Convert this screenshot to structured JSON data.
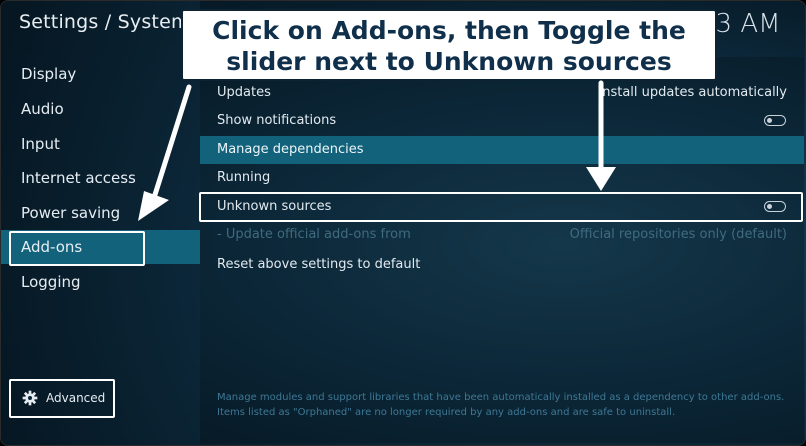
{
  "header": {
    "title": "Settings / System",
    "clock": "23 AM"
  },
  "sidebar": {
    "items": [
      {
        "label": "Display"
      },
      {
        "label": "Audio"
      },
      {
        "label": "Input"
      },
      {
        "label": "Internet access"
      },
      {
        "label": "Power saving"
      },
      {
        "label": "Add-ons",
        "selected": true
      },
      {
        "label": "Logging"
      }
    ],
    "advanced_label": "Advanced"
  },
  "settings": {
    "rows": [
      {
        "label": "Updates",
        "value": "Install updates automatically"
      },
      {
        "label": "Show notifications",
        "control": "toggle",
        "state": "off"
      },
      {
        "label": "Manage dependencies",
        "focused": true
      },
      {
        "label": "Running"
      },
      {
        "label": "Unknown sources",
        "control": "toggle",
        "state": "off"
      },
      {
        "label": "- Update official add-ons from",
        "value": "Official repositories only (default)",
        "disabled": true
      },
      {
        "label": "Reset above settings to default"
      }
    ],
    "help_text": "Manage modules and support libraries that have been automatically installed as a dependency to other add-ons. Items listed as \"Orphaned\" are no longer required by any add-ons and are safe to uninstall."
  },
  "callout": {
    "line1": "Click on Add-ons, then Toggle the",
    "line2": "slider next to Unknown sources"
  },
  "colors": {
    "selection": "#12627c",
    "background": "#0f3247",
    "callout_text": "#0f2f4a"
  }
}
